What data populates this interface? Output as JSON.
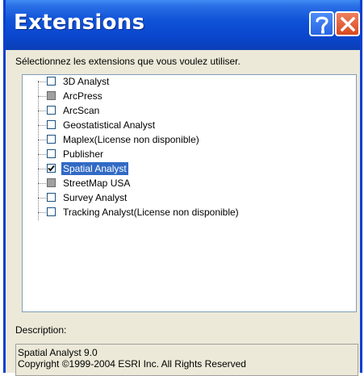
{
  "window": {
    "title": "Extensions",
    "help_glyph": "?",
    "close_glyph": "✕"
  },
  "instructions": "Sélectionnez les extensions que vous voulez utiliser.",
  "extensions": [
    {
      "label": "3D Analyst",
      "state": "unchecked"
    },
    {
      "label": "ArcPress",
      "state": "disabled"
    },
    {
      "label": "ArcScan",
      "state": "unchecked"
    },
    {
      "label": "Geostatistical Analyst",
      "state": "unchecked"
    },
    {
      "label": "Maplex(License non disponible)",
      "state": "unchecked"
    },
    {
      "label": "Publisher",
      "state": "unchecked"
    },
    {
      "label": "Spatial Analyst",
      "state": "checked",
      "selected": true
    },
    {
      "label": "StreetMap USA",
      "state": "disabled"
    },
    {
      "label": "Survey Analyst",
      "state": "unchecked"
    },
    {
      "label": "Tracking Analyst(License non disponible)",
      "state": "unchecked"
    }
  ],
  "description": {
    "label": "Description:",
    "line1": "Spatial Analyst 9.0",
    "line2": "Copyright ©1999-2004 ESRI Inc. All Rights Reserved"
  },
  "colors": {
    "titlebar": "#0a47cf",
    "selection": "#316ac5",
    "dialog_bg": "#ece9d8"
  }
}
